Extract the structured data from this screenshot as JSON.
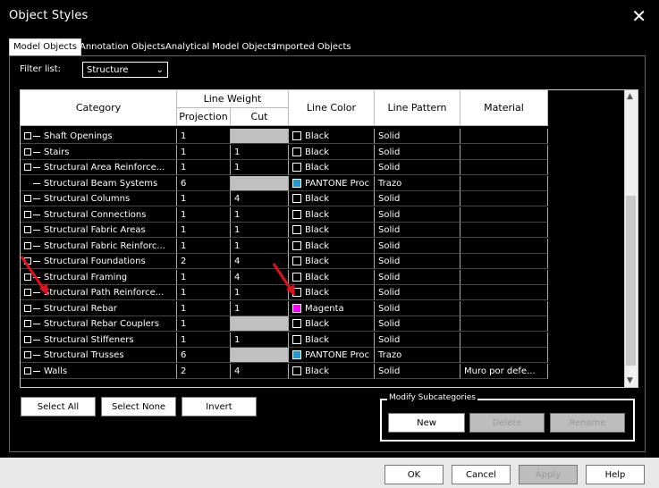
{
  "window": {
    "title": "Object Styles",
    "close_glyph": "✕"
  },
  "tabs": [
    "Model Objects",
    "Annotation Objects",
    "Analytical Model Objects",
    "Imported Objects"
  ],
  "filter": {
    "label": "Filter list:",
    "value": "Structure",
    "chevron": "⌄"
  },
  "table": {
    "headers": {
      "category": "Category",
      "line_weight": "Line Weight",
      "projection": "Projection",
      "cut": "Cut",
      "line_color": "Line Color",
      "line_pattern": "Line Pattern",
      "material": "Material"
    },
    "rows": [
      {
        "category": "Shaft Openings",
        "expander": true,
        "projection": "1",
        "cut": "",
        "cut_gray": true,
        "color_name": "Black",
        "swatch": "#000000",
        "pattern": "Solid",
        "material": ""
      },
      {
        "category": "Stairs",
        "expander": true,
        "projection": "1",
        "cut": "1",
        "cut_gray": false,
        "color_name": "Black",
        "swatch": "#000000",
        "pattern": "Solid",
        "material": ""
      },
      {
        "category": "Structural Area Reinforce...",
        "expander": true,
        "projection": "1",
        "cut": "1",
        "cut_gray": false,
        "color_name": "Black",
        "swatch": "#000000",
        "pattern": "Solid",
        "material": ""
      },
      {
        "category": "Structural Beam Systems",
        "expander": false,
        "projection": "6",
        "cut": "",
        "cut_gray": true,
        "color_name": "PANTONE Proc",
        "swatch": "#1e9bd7",
        "pattern": "Trazo",
        "material": ""
      },
      {
        "category": "Structural Columns",
        "expander": true,
        "projection": "1",
        "cut": "4",
        "cut_gray": false,
        "color_name": "Black",
        "swatch": "#000000",
        "pattern": "Solid",
        "material": ""
      },
      {
        "category": "Structural Connections",
        "expander": true,
        "projection": "1",
        "cut": "1",
        "cut_gray": false,
        "color_name": "Black",
        "swatch": "#000000",
        "pattern": "Solid",
        "material": ""
      },
      {
        "category": "Structural Fabric Areas",
        "expander": true,
        "projection": "1",
        "cut": "1",
        "cut_gray": false,
        "color_name": "Black",
        "swatch": "#000000",
        "pattern": "Solid",
        "material": ""
      },
      {
        "category": "Structural Fabric Reinforc...",
        "expander": true,
        "projection": "1",
        "cut": "1",
        "cut_gray": false,
        "color_name": "Black",
        "swatch": "#000000",
        "pattern": "Solid",
        "material": ""
      },
      {
        "category": "Structural Foundations",
        "expander": true,
        "projection": "2",
        "cut": "4",
        "cut_gray": false,
        "color_name": "Black",
        "swatch": "#000000",
        "pattern": "Solid",
        "material": ""
      },
      {
        "category": "Structural Framing",
        "expander": true,
        "projection": "1",
        "cut": "4",
        "cut_gray": false,
        "color_name": "Black",
        "swatch": "#000000",
        "pattern": "Solid",
        "material": ""
      },
      {
        "category": "Structural Path Reinforce...",
        "expander": true,
        "projection": "1",
        "cut": "1",
        "cut_gray": false,
        "color_name": "Black",
        "swatch": "#000000",
        "pattern": "Solid",
        "material": ""
      },
      {
        "category": "Structural Rebar",
        "expander": true,
        "projection": "1",
        "cut": "1",
        "cut_gray": false,
        "color_name": "Magenta",
        "swatch": "#ff00ff",
        "pattern": "Solid",
        "material": ""
      },
      {
        "category": "Structural Rebar Couplers",
        "expander": true,
        "projection": "1",
        "cut": "",
        "cut_gray": true,
        "color_name": "Black",
        "swatch": "#000000",
        "pattern": "Solid",
        "material": ""
      },
      {
        "category": "Structural Stiffeners",
        "expander": true,
        "projection": "1",
        "cut": "1",
        "cut_gray": false,
        "color_name": "Black",
        "swatch": "#000000",
        "pattern": "Solid",
        "material": ""
      },
      {
        "category": "Structural Trusses",
        "expander": true,
        "projection": "6",
        "cut": "",
        "cut_gray": true,
        "color_name": "PANTONE Proc",
        "swatch": "#1e9bd7",
        "pattern": "Trazo",
        "material": ""
      },
      {
        "category": "Walls",
        "expander": true,
        "projection": "2",
        "cut": "4",
        "cut_gray": false,
        "color_name": "Black",
        "swatch": "#000000",
        "pattern": "Solid",
        "material": "Muro por defe..."
      }
    ]
  },
  "buttons": {
    "select_all": "Select All",
    "select_none": "Select None",
    "invert": "Invert",
    "modify_group": "Modify Subcategories",
    "new": "New",
    "delete": "Delete",
    "rename": "Rename",
    "ok": "OK",
    "cancel": "Cancel",
    "apply": "Apply",
    "help": "Help"
  },
  "colors": {
    "annotation_arrow": "#e0101a",
    "background": "#000000"
  }
}
